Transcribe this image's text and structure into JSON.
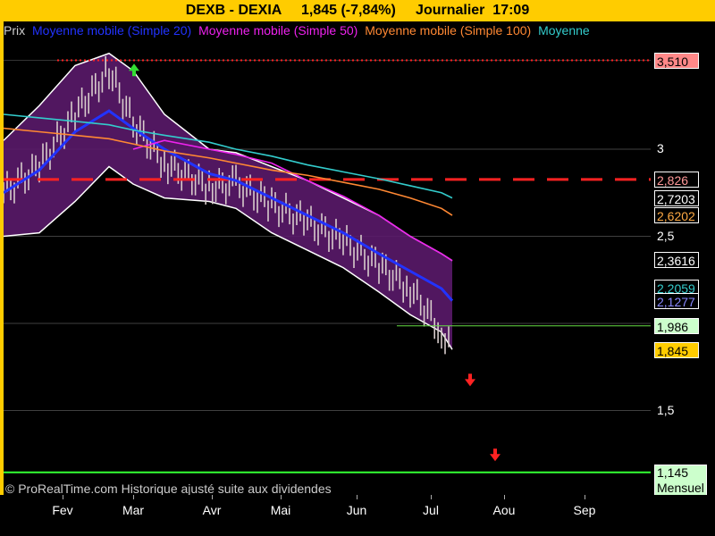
{
  "title": "DEXB - DEXIA     1,845 (-7,84%)     Journalier  17:09",
  "legend": [
    {
      "label": "Prix",
      "color": "#cccccc"
    },
    {
      "label": "Moyenne mobile (Simple 20)",
      "color": "#2233ff"
    },
    {
      "label": "Moyenne mobile (Simple 50)",
      "color": "#ee22ee"
    },
    {
      "label": "Moyenne mobile (Simple 100)",
      "color": "#ff8833"
    },
    {
      "label": "Moyenne",
      "color": "#33cccc"
    }
  ],
  "copyright": "© ProRealTime.com Historique ajusté suite aux dividendes",
  "chart_data": {
    "type": "line",
    "x_axis_labels": [
      "Fev",
      "Mar",
      "Avr",
      "Mai",
      "Jun",
      "Jul",
      "Aou",
      "Sep"
    ],
    "y_ticks": [
      "3",
      "2,5",
      "1,5"
    ],
    "ylim": [
      1.0,
      3.6
    ],
    "grid": true,
    "price": [
      {
        "x": "Jan",
        "y": 2.75
      },
      {
        "x": "early Feb",
        "y": 2.9
      },
      {
        "x": "mid Feb",
        "y": 3.2
      },
      {
        "x": "late Feb",
        "y": 3.45
      },
      {
        "x": "Mar",
        "y": 3.15
      },
      {
        "x": "mid Mar",
        "y": 2.92
      },
      {
        "x": "Apr",
        "y": 2.78
      },
      {
        "x": "late Apr",
        "y": 2.8
      },
      {
        "x": "Mai",
        "y": 2.68
      },
      {
        "x": "mid Mai",
        "y": 2.58
      },
      {
        "x": "Jun",
        "y": 2.47
      },
      {
        "x": "mid Jun",
        "y": 2.33
      },
      {
        "x": "late Jun",
        "y": 2.2
      },
      {
        "x": "Jul",
        "y": 1.95
      },
      {
        "x": "Jul close",
        "y": 1.845
      }
    ],
    "series": [
      {
        "name": "Moyenne mobile (Simple 20)",
        "color": "#2233ff",
        "values": [
          2.75,
          2.88,
          3.1,
          3.22,
          3.12,
          3.0,
          2.86,
          2.82,
          2.72,
          2.62,
          2.52,
          2.4,
          2.3,
          2.2,
          2.13
        ]
      },
      {
        "name": "Moyenne mobile (Simple 50)",
        "color": "#ee22ee",
        "values": [
          null,
          null,
          null,
          null,
          3.0,
          3.05,
          3.0,
          2.97,
          2.92,
          2.82,
          2.73,
          2.62,
          2.5,
          2.4,
          2.36
        ]
      },
      {
        "name": "Moyenne mobile (Simple 100)",
        "color": "#ff8833",
        "values": [
          3.12,
          3.1,
          3.08,
          3.06,
          3.03,
          2.99,
          2.95,
          2.92,
          2.88,
          2.85,
          2.81,
          2.77,
          2.72,
          2.66,
          2.62
        ]
      },
      {
        "name": "Moyenne",
        "color": "#33cccc",
        "values": [
          3.2,
          3.18,
          3.16,
          3.14,
          3.11,
          3.08,
          3.04,
          3.0,
          2.96,
          2.91,
          2.87,
          2.83,
          2.79,
          2.75,
          2.72
        ]
      }
    ],
    "bollinger_upper": [
      3.05,
      3.25,
      3.48,
      3.55,
      3.45,
      3.2,
      3.0,
      2.98,
      2.9,
      2.82,
      2.72,
      2.62,
      2.5,
      2.4,
      2.36
    ],
    "bollinger_lower": [
      2.5,
      2.52,
      2.7,
      2.9,
      2.8,
      2.72,
      2.7,
      2.66,
      2.52,
      2.42,
      2.32,
      2.18,
      2.05,
      1.95,
      1.85
    ],
    "horizontal_lines": [
      {
        "value": 3.51,
        "label": "3,510",
        "style": "dotted",
        "color": "#ff2222"
      },
      {
        "value": 2.826,
        "label": "2,826",
        "style": "dashed",
        "color": "#ff2222"
      },
      {
        "value": 1.986,
        "label": "1,986",
        "style": "solid",
        "color": "#66dd44"
      },
      {
        "value": 1.145,
        "label": "1,145",
        "style": "solid",
        "color": "#33ff33"
      }
    ],
    "value_labels": [
      {
        "value": 3.51,
        "text": "3,510",
        "bg": "#ff8888",
        "fg": "#000000"
      },
      {
        "value": 2.826,
        "text": "2,826",
        "bg": "#000000",
        "fg": "#ff9999"
      },
      {
        "value": 2.7203,
        "text": "2,7203",
        "bg": "#000000",
        "fg": "#ffffff"
      },
      {
        "value": 2.6202,
        "text": "2,6202",
        "bg": "#000000",
        "fg": "#ffaa44"
      },
      {
        "value": 2.3616,
        "text": "2,3616",
        "bg": "#000000",
        "fg": "#ffffff"
      },
      {
        "value": 2.2059,
        "text": "2,2059",
        "bg": "#000000",
        "fg": "#33cccc"
      },
      {
        "value": 2.1277,
        "text": "2,1277",
        "bg": "#000000",
        "fg": "#8888ff"
      },
      {
        "value": 1.986,
        "text": "1,986",
        "bg": "#ccffcc",
        "fg": "#000000"
      },
      {
        "value": 1.845,
        "text": "1,845",
        "bg": "#ffcc00",
        "fg": "#000000"
      },
      {
        "value": 1.145,
        "text": "1,145",
        "bg": "#ccffcc",
        "fg": "#000000",
        "sub": "Mensuel"
      }
    ],
    "signals": [
      {
        "type": "up",
        "color": "#33dd33",
        "x_date": "late Feb",
        "y": 3.45
      },
      {
        "type": "down",
        "color": "#ff2222",
        "x_date": "mid Jul",
        "y": 1.68
      },
      {
        "type": "down",
        "color": "#ff2222",
        "x_date": "late Jul",
        "y": 1.25
      }
    ]
  }
}
